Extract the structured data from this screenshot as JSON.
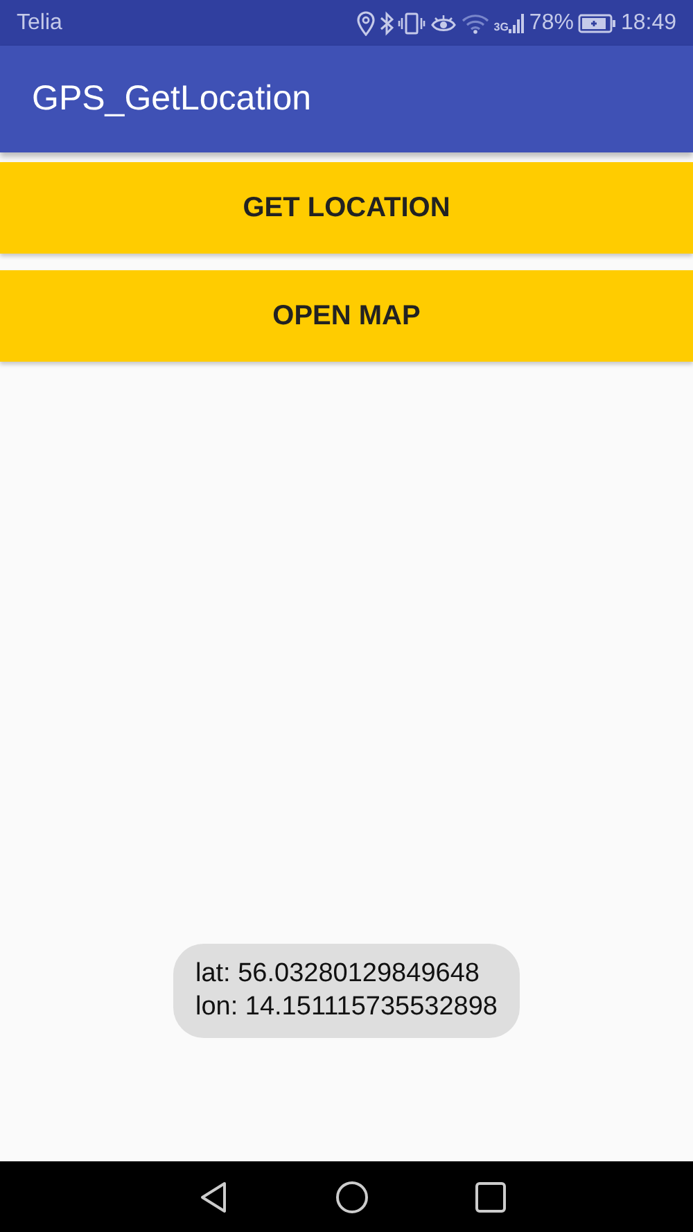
{
  "status_bar": {
    "carrier": "Telia",
    "network": "3G",
    "battery": "78%",
    "time": "18:49"
  },
  "app_bar": {
    "title": "GPS_GetLocation"
  },
  "buttons": [
    "GET LOCATION",
    "OPEN MAP"
  ],
  "toast": {
    "lines": [
      "lat: 56.03280129849648",
      "lon: 14.151115735532898"
    ]
  }
}
